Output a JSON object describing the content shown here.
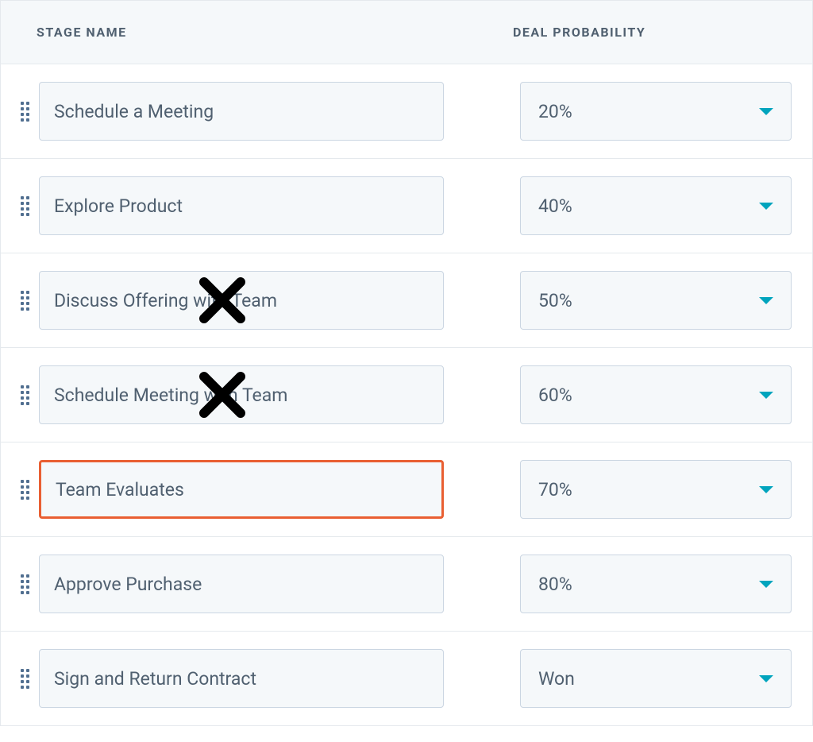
{
  "headers": {
    "stage_name": "STAGE NAME",
    "deal_probability": "DEAL PROBABILITY"
  },
  "stages": [
    {
      "name": "Schedule a Meeting",
      "probability": "20%",
      "highlighted": false,
      "crossed": false
    },
    {
      "name": "Explore Product",
      "probability": "40%",
      "highlighted": false,
      "crossed": false
    },
    {
      "name": "Discuss Offering with Team",
      "probability": "50%",
      "highlighted": false,
      "crossed": true
    },
    {
      "name": "Schedule Meeting with Team",
      "probability": "60%",
      "highlighted": false,
      "crossed": true
    },
    {
      "name": "Team Evaluates",
      "probability": "70%",
      "highlighted": true,
      "crossed": false
    },
    {
      "name": "Approve Purchase",
      "probability": "80%",
      "highlighted": false,
      "crossed": false
    },
    {
      "name": "Sign and Return Contract",
      "probability": "Won",
      "highlighted": false,
      "crossed": false
    }
  ],
  "annotations": {
    "x_mark_color": "#000000",
    "highlight_color": "#e95f32"
  }
}
